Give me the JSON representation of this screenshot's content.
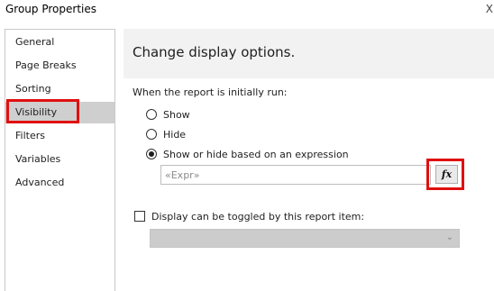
{
  "window": {
    "title": "Group Properties",
    "close_fragment": "X"
  },
  "sidebar": {
    "items": [
      {
        "label": "General"
      },
      {
        "label": "Page Breaks"
      },
      {
        "label": "Sorting"
      },
      {
        "label": "Visibility",
        "selected": true
      },
      {
        "label": "Filters"
      },
      {
        "label": "Variables"
      },
      {
        "label": "Advanced"
      }
    ]
  },
  "main": {
    "heading": "Change display options.",
    "group_label": "When the report is initially run:",
    "options": [
      {
        "label": "Show",
        "checked": false
      },
      {
        "label": "Hide",
        "checked": false
      },
      {
        "label": "Show or hide based on an expression",
        "checked": true
      }
    ],
    "expression": {
      "value": "",
      "placeholder": "«Expr»",
      "fx_label": "fx"
    },
    "toggle": {
      "label": "Display can be toggled by this report item:",
      "checked": false,
      "dropdown_value": ""
    }
  },
  "colors": {
    "highlight": "#e01010",
    "selected_bg": "#cfcfcf",
    "header_bg": "#f2f2f2"
  }
}
